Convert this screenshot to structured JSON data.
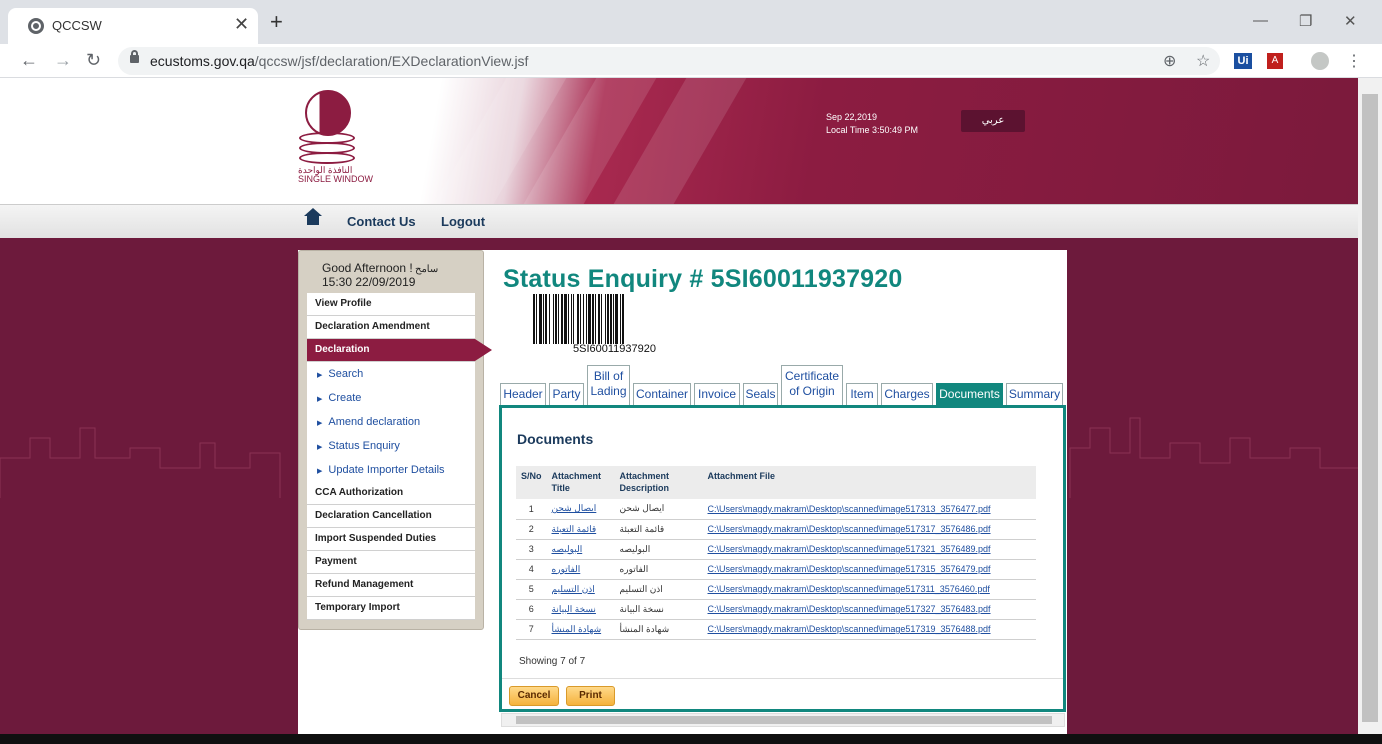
{
  "browser": {
    "tab_title": "QCCSW",
    "tab_close": "✕",
    "new_tab": "+",
    "url_host": "ecustoms.gov.qa",
    "url_path": "/qccsw/jsf/declaration/EXDeclarationView.jsf",
    "icons": [
      "globe-icon",
      "back-icon",
      "forward-icon",
      "reload-icon",
      "lock-icon",
      "zoom-icon",
      "star-icon",
      "ui-extension-icon",
      "pdf-extension-icon",
      "profile-icon",
      "menu-icon"
    ],
    "ext_ui": "Ui",
    "ext_pdf": "A"
  },
  "header": {
    "logo_text_ar": "النافذة الواحدة",
    "logo_text_en": "SINGLE WINDOW",
    "date": "Sep 22,2019",
    "local_time": "Local Time 3:50:49 PM",
    "lang_button": "عربي"
  },
  "topnav": {
    "contact": "Contact Us",
    "logout": "Logout"
  },
  "sidebar": {
    "greeting": "Good Afternoon  !",
    "greeting_ar": "سامح",
    "datetime": "15:30 22/09/2019",
    "items": [
      {
        "label": "View Profile"
      },
      {
        "label": "Declaration Amendment"
      },
      {
        "label": "Declaration",
        "active": true
      },
      {
        "label": "Search",
        "sub": true
      },
      {
        "label": "Create",
        "sub": true
      },
      {
        "label": "Amend declaration",
        "sub": true
      },
      {
        "label": "Status Enquiry",
        "sub": true
      },
      {
        "label": "Update Importer Details",
        "sub": true
      },
      {
        "label": "CCA Authorization"
      },
      {
        "label": "Declaration Cancellation"
      },
      {
        "label": "Import Suspended Duties"
      },
      {
        "label": "Payment"
      },
      {
        "label": "Refund Management"
      },
      {
        "label": "Temporary Import"
      }
    ]
  },
  "main": {
    "title": "Status Enquiry # 5SI60011937920",
    "barcode_number": "5SI60011937920",
    "tabs": [
      {
        "line1": "Header"
      },
      {
        "line1": "Party"
      },
      {
        "line1": "Bill of",
        "line2": "Lading"
      },
      {
        "line1": "Container"
      },
      {
        "line1": "Invoice"
      },
      {
        "line1": "Seals"
      },
      {
        "line1": "Certificate",
        "line2": "of Origin"
      },
      {
        "line1": "Item"
      },
      {
        "line1": "Charges"
      },
      {
        "line1": "Documents",
        "active": true
      },
      {
        "line1": "Summary"
      }
    ],
    "documents": {
      "heading": "Documents",
      "columns": {
        "sno": "S/No",
        "title_1": "Attachment",
        "title_2": "Title",
        "desc_1": "Attachment",
        "desc_2": "Description",
        "file": "Attachment File"
      },
      "rows": [
        {
          "sno": "1",
          "title": "ايصال شحن",
          "desc": "ايصال شحن",
          "file": "C:\\Users\\magdy.makram\\Desktop\\scanned\\image517313_3576477.pdf"
        },
        {
          "sno": "2",
          "title": "قائمة التعبئة",
          "desc": "قائمة التعبئة",
          "file": "C:\\Users\\magdy.makram\\Desktop\\scanned\\image517317_3576486.pdf"
        },
        {
          "sno": "3",
          "title": "البوليصه",
          "desc": "البوليصه",
          "file": "C:\\Users\\magdy.makram\\Desktop\\scanned\\image517321_3576489.pdf"
        },
        {
          "sno": "4",
          "title": "الفاتوره",
          "desc": "الفاتوره",
          "file": "C:\\Users\\magdy.makram\\Desktop\\scanned\\image517315_3576479.pdf"
        },
        {
          "sno": "5",
          "title": "اذن التسليم",
          "desc": "اذن التسليم",
          "file": "C:\\Users\\magdy.makram\\Desktop\\scanned\\image517311_3576460.pdf"
        },
        {
          "sno": "6",
          "title": "نسخة البيانة",
          "desc": "نسخة البيانة",
          "file": "C:\\Users\\magdy.makram\\Desktop\\scanned\\image517327_3576483.pdf"
        },
        {
          "sno": "7",
          "title": "شهادة المنشأ",
          "desc": "شهادة المنشأ",
          "file": "C:\\Users\\magdy.makram\\Desktop\\scanned\\image517319_3576488.pdf"
        }
      ],
      "showing": "Showing 7 of 7"
    },
    "buttons": {
      "cancel": "Cancel",
      "print": "Print"
    }
  },
  "colors": {
    "brand_maroon": "#8c1c41",
    "teal_accent": "#11877e",
    "link_blue": "#1f4fa0",
    "button_orange": "#f5b23c"
  }
}
